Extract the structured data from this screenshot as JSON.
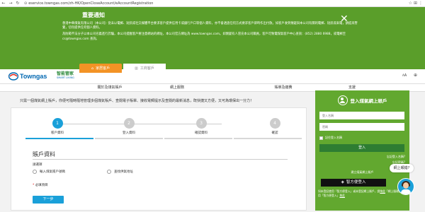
{
  "browser": {
    "url": "eservice.towngas.com/zh-HK/OpenCloseAccount/eAccountRegistration"
  },
  "notice": {
    "title": "重要通知",
    "paragraphs": [
      "香港中華煤氣有限公司（本公司）從未以電郵、短訊或社交媒體平台要求客戶提供信用卡或銀行戶口等個人資料，亦不會透過任何方式要求客戶即時作出付款。如客戶收到懷疑與本公司有關的電郵、短訊或來電，請提高警覺，切勿提供任何個人資料。",
      "為防範不法分子以本公司名義進行詐騙，本公司提醒客戶要注意網站的網址，本公司官方網址為 www.towngas.com。如懷疑有人冒充本公司職員，客戶可致電煤氣客戶中心查詢：(852) 2880 6988，或電郵至 cs@towngas.com 查詢。"
    ]
  },
  "header": {
    "brand": "Towngas",
    "sub_brand_main": "智能管家",
    "sub_brand_sub": "SMART LIVING",
    "tab_home": "家居客戶",
    "tab_business": "工商客戶",
    "font_size_label": "A",
    "font_size_small": "A",
    "lang_icon": "globe-icon"
  },
  "mainnav": [
    "關於及煤氣賬戶",
    "網上服務",
    "賬單及繳費",
    "支援"
  ],
  "intro": "只需一個煤氣網上賬戶，你便可隨時隨地管理多個煤氣賬戶、查閱電子賬單、接收電郵提示及查閱的最新消息，既快捷又方便，又可為環保出一分力！",
  "steps": [
    {
      "number": "1",
      "label": "賬戶資料"
    },
    {
      "number": "2",
      "label": "登入資料"
    },
    {
      "number": "3",
      "label": "確認資料"
    },
    {
      "number": "4",
      "label": "確認"
    }
  ],
  "form": {
    "section_title": "賬戶資料",
    "question_label": "請選擇",
    "option_account": "輸入煤氣賬戶號碼",
    "option_address": "查找供氣地址",
    "required_note": "必填項目",
    "next_button": "下一步"
  },
  "login": {
    "title": "登入煤氣網上賬戶",
    "username_placeholder": "登入名稱",
    "password_placeholder": "密碼",
    "remember_label": "記住登入名稱",
    "login_button": "登入",
    "forgot_username": "忘記登入名稱?",
    "forgot_password": "忘記密碼?",
    "register_text": "建立煤氣網上賬戶",
    "smart_button": "智方便登入",
    "smart_note_prefix": "如未登記使用「智方便登入」或未登記網上賬戶，請",
    "smart_link_1": "按此",
    "smart_note_mid": "「網上服務」及使用「智方便登入」",
    "smart_link_2": "按此"
  },
  "chat": {
    "bubble": "網上報錯?"
  },
  "colors": {
    "brand_green": "#5a9e2a",
    "login_green": "#62a82f",
    "accent_blue": "#1aa0d9",
    "tab_orange": "#f39325"
  }
}
